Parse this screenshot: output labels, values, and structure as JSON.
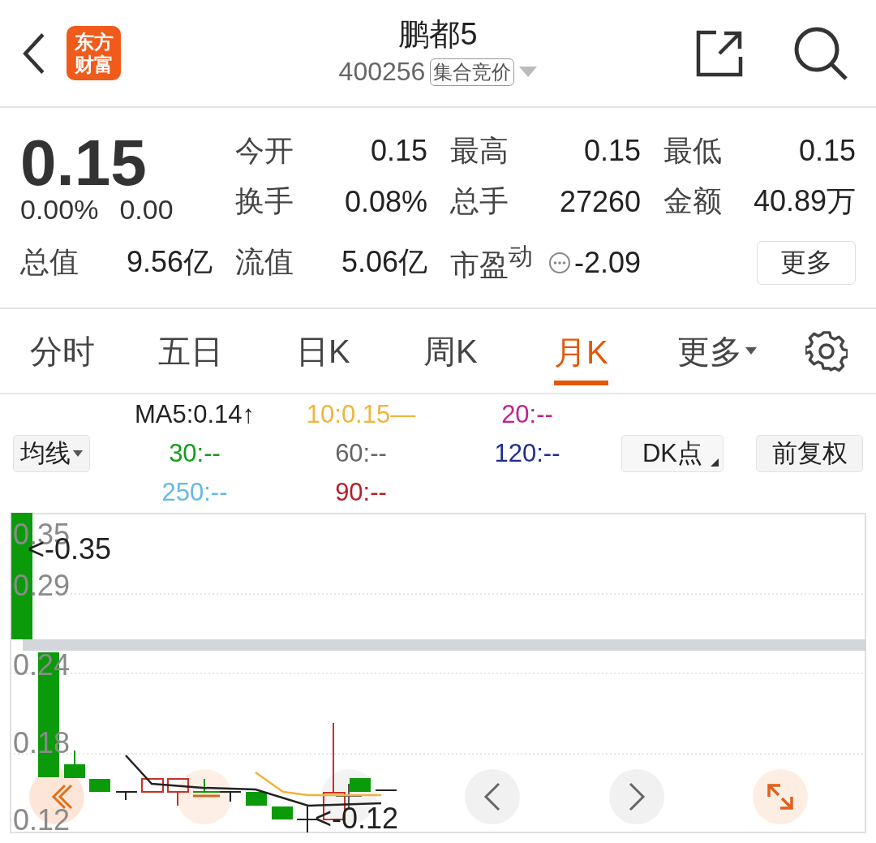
{
  "header": {
    "logo": [
      "东方",
      "财富"
    ],
    "title": "鹏都5",
    "code": "400256",
    "status_badge": "集合竞价"
  },
  "quote": {
    "price": "0.15",
    "change_pct": "0.00%",
    "change": "0.00",
    "stats": [
      {
        "label": "今开",
        "value": "0.15"
      },
      {
        "label": "最高",
        "value": "0.15"
      },
      {
        "label": "最低",
        "value": "0.15"
      },
      {
        "label": "换手",
        "value": "0.08%"
      },
      {
        "label": "总手",
        "value": "27260"
      },
      {
        "label": "金额",
        "value": "40.89万"
      }
    ],
    "bottom_stats": [
      {
        "label": "总值",
        "value": "9.56亿",
        "kind": "plain"
      },
      {
        "label": "流值",
        "value": "5.06亿",
        "kind": "plain"
      },
      {
        "label": "市盈$^{动}$",
        "value": "-2.09",
        "kind": "info"
      }
    ],
    "more_button": "更多"
  },
  "tabs": [
    {
      "label": "分时",
      "selected": false,
      "kind": "plain"
    },
    {
      "label": "五日",
      "selected": false,
      "kind": "plain"
    },
    {
      "label": "日K",
      "selected": false,
      "kind": "plain"
    },
    {
      "label": "周K",
      "selected": false,
      "kind": "plain"
    },
    {
      "label": "月K",
      "selected": true,
      "kind": "plain"
    },
    {
      "label": "更多",
      "selected": false,
      "kind": "dropdown"
    }
  ],
  "indicator_bar": {
    "ma_button": "均线",
    "dk_button": "DK点",
    "adjust_button": "前复权",
    "legend": [
      {
        "label": "MA5:0.14↑",
        "color": "#222222"
      },
      {
        "label": "10:0.15—",
        "color": "#f0b43c"
      },
      {
        "label": "20:--",
        "color": "#c0228c"
      },
      {
        "label": "30:--",
        "color": "#179a17"
      },
      {
        "label": "60:--",
        "color": "#666666"
      },
      {
        "label": "120:--",
        "color": "#1c2f8f"
      },
      {
        "label": "250:--",
        "color": "#66b8e6"
      },
      {
        "label": "90:--",
        "color": "#b3202c"
      }
    ]
  },
  "chart": {
    "y_labels": [
      "0.35",
      "0.29",
      "0.24",
      "0.18",
      "0.12"
    ],
    "high_marker": "<-0.35",
    "low_marker": "<-0.12"
  }
}
